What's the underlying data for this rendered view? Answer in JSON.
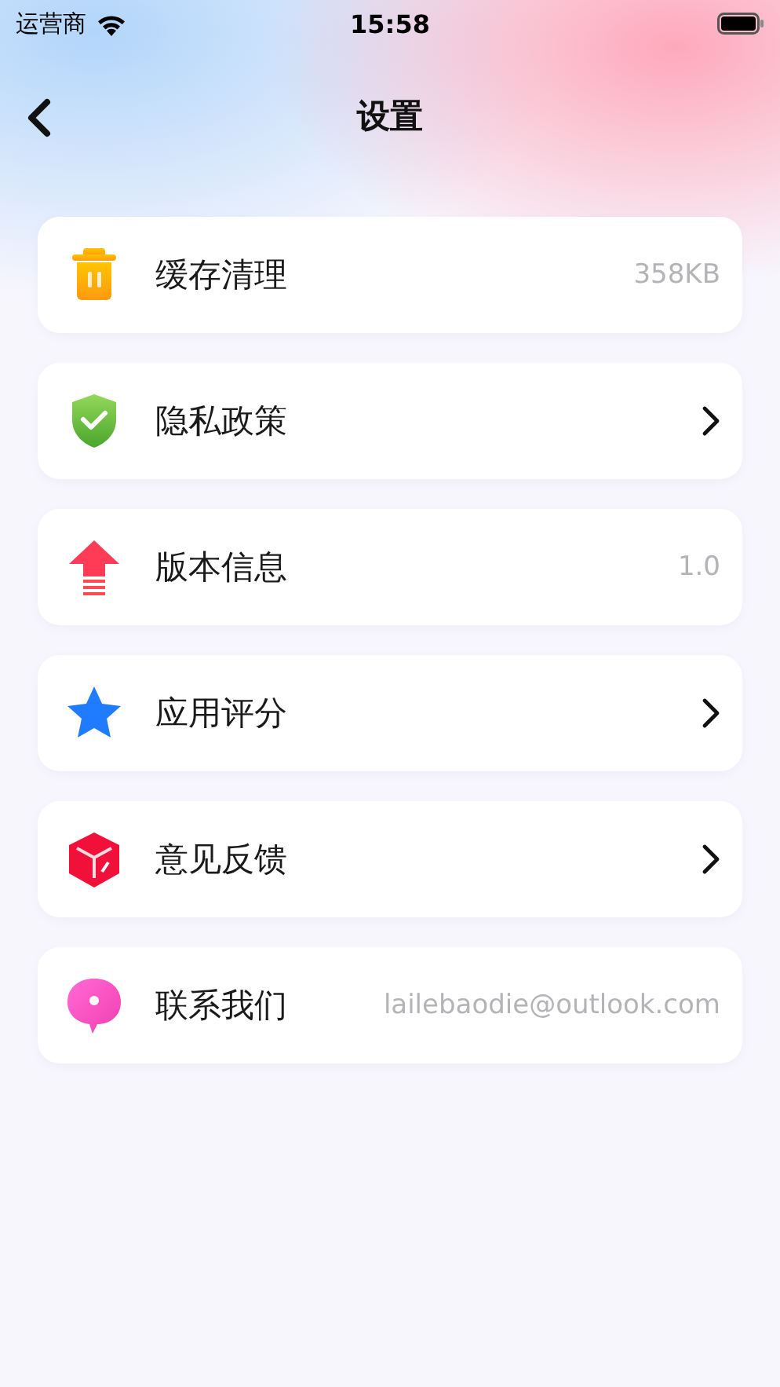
{
  "status_bar": {
    "carrier": "运营商",
    "time": "15:58"
  },
  "nav": {
    "title": "设置"
  },
  "items": [
    {
      "label": "缓存清理",
      "kind": "value",
      "value": "358KB"
    },
    {
      "label": "隐私政策",
      "kind": "chevron"
    },
    {
      "label": "版本信息",
      "kind": "value",
      "value": "1.0"
    },
    {
      "label": "应用评分",
      "kind": "chevron"
    },
    {
      "label": "意见反馈",
      "kind": "chevron"
    },
    {
      "label": "联系我们",
      "kind": "value",
      "value": "lailebaodie@outlook.com"
    }
  ]
}
